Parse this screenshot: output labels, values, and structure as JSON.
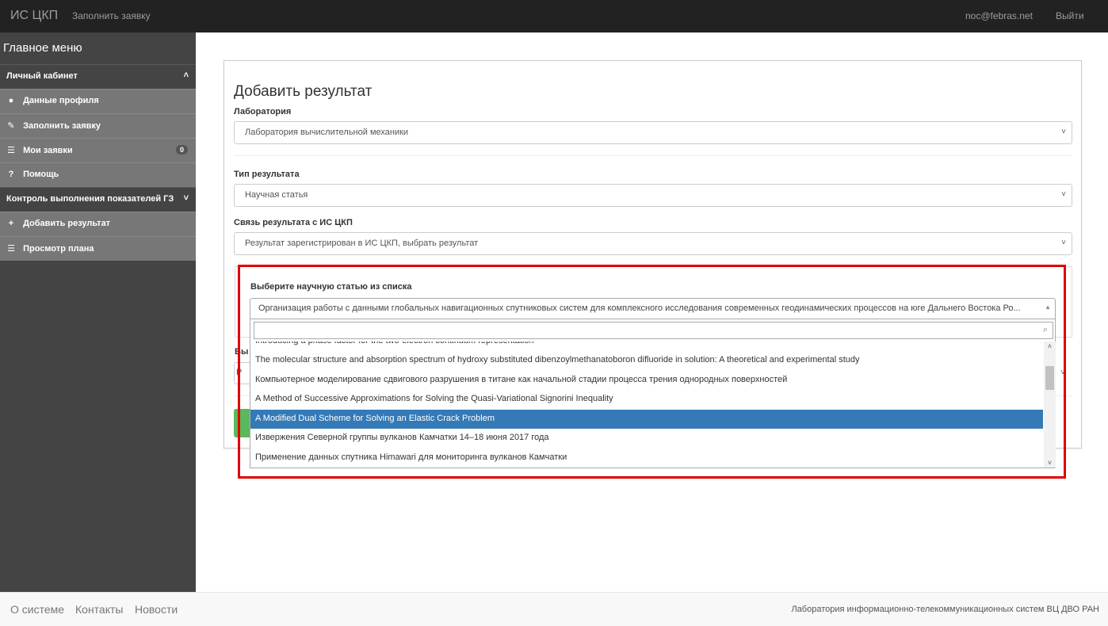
{
  "navbar": {
    "brand": "ИС ЦКП",
    "fill_request": "Заполнить заявку",
    "user_email": "noc@febras.net",
    "logout": "Выйти"
  },
  "sidebar": {
    "title": "Главное меню",
    "section_personal": "Личный кабинет",
    "items_personal": [
      {
        "label": "Данные профиля",
        "icon": "user-icon"
      },
      {
        "label": "Заполнить заявку",
        "icon": "pencil-icon"
      },
      {
        "label": "Мои заявки",
        "icon": "list-icon",
        "badge": "0"
      },
      {
        "label": "Помощь",
        "icon": "question-icon"
      }
    ],
    "section_control": "Контроль выполнения показателей ГЗ",
    "items_control": [
      {
        "label": "Добавить результат",
        "icon": "plus-icon"
      },
      {
        "label": "Просмотр плана",
        "icon": "list-icon"
      }
    ]
  },
  "form": {
    "title": "Добавить результат",
    "lab_label": "Лаборатория",
    "lab_value": "Лаборатория вычислительной механики",
    "type_label": "Тип результата",
    "type_value": "Научная статья",
    "link_label": "Связь результата с ИС ЦКП",
    "link_value": "Результат зарегистрирован в ИС ЦКП, выбрать результат",
    "article_label": "Выберите научную статью из списка",
    "article_value": "Организация работы с данными глобальных навигационных спутниковых систем для комплексного исследования современных геодинамических процессов на юге Дальнего Востока Ро...",
    "hidden_label_peek": "Вы",
    "hidden_select_peek": "Р",
    "search_placeholder": "",
    "options": [
      "Introducing a phase factor for the two-electron continuum representation",
      "The molecular structure and absorption spectrum of hydroxy substituted dibenzoylmethanatoboron difluoride in solution: A theoretical and experimental study",
      "Компьютерное моделирование сдвигового разрушения в титане как начальной стадии процесса трения однородных поверхностей",
      "A Method of Successive Approximations for Solving the Quasi-Variational Signorini Inequality",
      "A Modified Dual Scheme for Solving an Elastic Crack Problem",
      "Извержения Северной группы вулканов Камчатки 14–18 июня 2017 года",
      "Применение данных спутника Himawari для мониторинга вулканов Камчатки"
    ],
    "selected_option": "A Modified Dual Scheme for Solving an Elastic Crack Problem"
  },
  "footer": {
    "about": "О системе",
    "contacts": "Контакты",
    "news": "Новости",
    "org": "Лаборатория информационно-телекоммуникационных систем ВЦ ДВО РАН"
  },
  "colors": {
    "navbar_bg": "#222222",
    "sidebar_bg": "#444444",
    "sidebar_item_bg": "#777777",
    "selected_option_bg": "#337ab7",
    "highlight_border": "#e00000",
    "button_green": "#5cb85c"
  }
}
